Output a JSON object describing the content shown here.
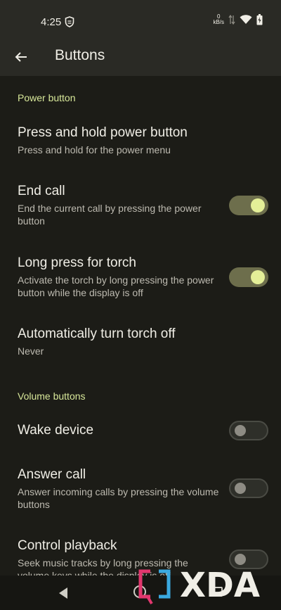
{
  "status": {
    "time": "4:25",
    "network_rate_value": "0",
    "network_rate_unit": "kB/s"
  },
  "appbar": {
    "title": "Buttons"
  },
  "sections": {
    "power": "Power button",
    "volume": "Volume buttons"
  },
  "items": [
    {
      "title": "Press and hold power button",
      "subtitle": "Press and hold for the power menu",
      "toggle": null
    },
    {
      "title": "End call",
      "subtitle": "End the current call by pressing the power button",
      "toggle": true
    },
    {
      "title": "Long press for torch",
      "subtitle": "Activate the torch by long pressing the power button while the display is off",
      "toggle": true
    },
    {
      "title": "Automatically turn torch off",
      "subtitle": "Never",
      "toggle": null
    },
    {
      "title": "Wake device",
      "subtitle": "",
      "toggle": false
    },
    {
      "title": "Answer call",
      "subtitle": "Answer incoming calls by pressing the volume buttons",
      "toggle": false
    },
    {
      "title": "Control playback",
      "subtitle": "Seek music tracks by long pressing the volume keys while the display is off",
      "toggle": false
    }
  ],
  "watermark": {
    "text": "XDA"
  },
  "colors": {
    "accent": "#d8e89a",
    "toggle_on_track": "#6d6e4c",
    "toggle_on_knob": "#e4ef98",
    "background": "#1c1c17"
  }
}
